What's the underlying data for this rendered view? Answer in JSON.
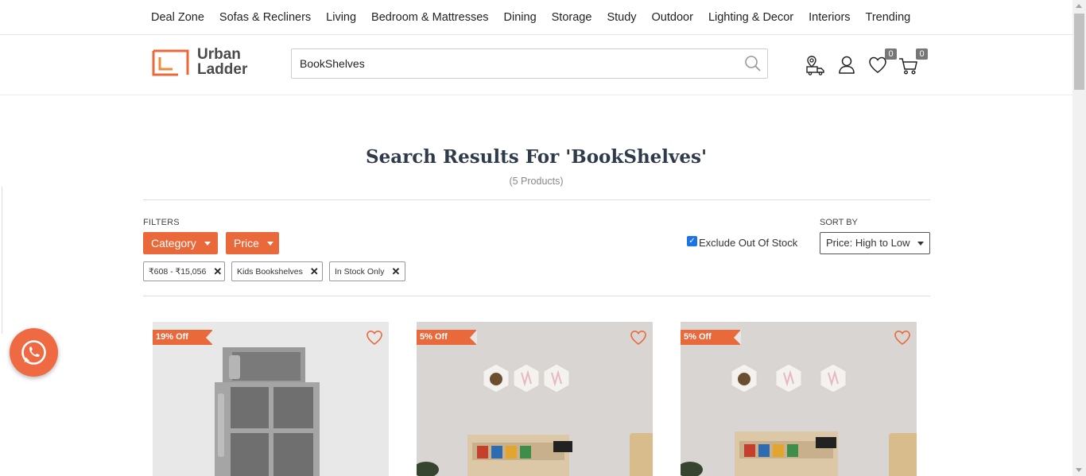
{
  "nav": {
    "items": [
      "Deal Zone",
      "Sofas & Recliners",
      "Living",
      "Bedroom & Mattresses",
      "Dining",
      "Storage",
      "Study",
      "Outdoor",
      "Lighting & Decor",
      "Interiors",
      "Trending"
    ]
  },
  "header": {
    "logo_line1": "Urban",
    "logo_line2": "Ladder",
    "search_value": "BookShelves",
    "wishlist_count": "0",
    "cart_count": "0"
  },
  "results": {
    "title": "Search Results For 'BookShelves'",
    "count": "(5 Products)"
  },
  "filters": {
    "label": "FILTERS",
    "category_label": "Category",
    "price_label": "Price",
    "chips": [
      "₹608 - ₹15,056",
      "Kids Bookshelves",
      "In Stock Only"
    ],
    "exclude_label": "Exclude Out Of Stock",
    "exclude_checked": true
  },
  "sort": {
    "label": "SORT BY",
    "selected": "Price: High to Low"
  },
  "products": [
    {
      "discount": "19% Off"
    },
    {
      "discount": "5% Off"
    },
    {
      "discount": "5% Off"
    }
  ],
  "colors": {
    "accent": "#e9693a",
    "whatsapp_button": "#ef6a43"
  }
}
